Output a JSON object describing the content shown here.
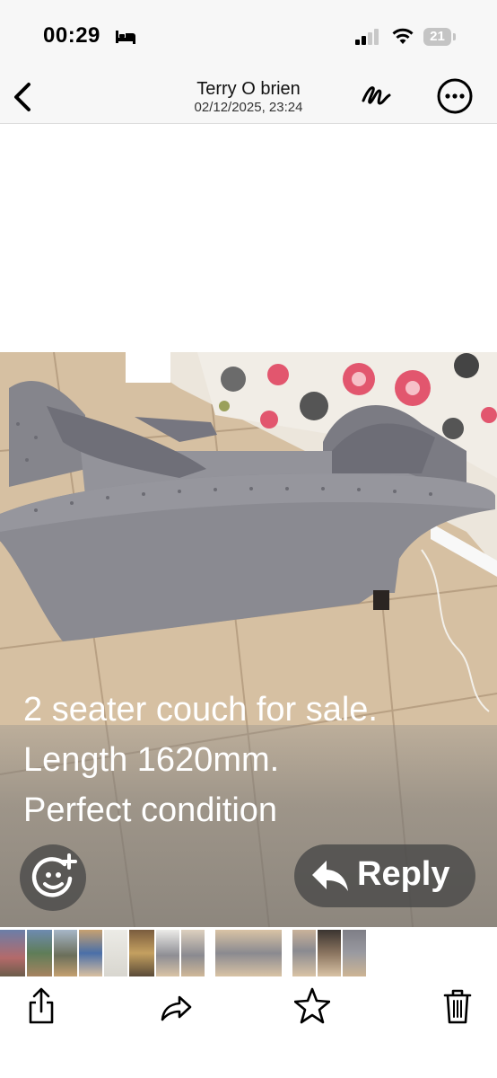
{
  "status_bar": {
    "time": "00:29",
    "battery_level": "21",
    "focus_icon": "bed-icon",
    "signal_icon": "cellular-signal-icon",
    "wifi_icon": "wifi-icon"
  },
  "nav": {
    "title": "Terry O brien",
    "subtitle": "02/12/2025, 23:24",
    "back_icon": "chevron-left-icon",
    "markup_icon": "markup-icon",
    "more_icon": "ellipsis-circle-icon"
  },
  "photo": {
    "caption_lines": [
      "2 seater couch for sale.",
      "Length 1620mm.",
      "Perfect condition"
    ],
    "reply_label": "Reply",
    "sticker_icon": "add-sticker-icon",
    "reply_icon": "reply-arrow-icon"
  },
  "thumbnails": {
    "count": 15
  },
  "toolbar": {
    "share_icon": "share-icon",
    "forward_icon": "forward-icon",
    "star_icon": "star-icon",
    "trash_icon": "trash-icon"
  },
  "colors": {
    "bar_background": "#f7f7f7",
    "couch": "#8a8a90",
    "floor": "#d9c3a5",
    "overlay_button": "#464646"
  }
}
